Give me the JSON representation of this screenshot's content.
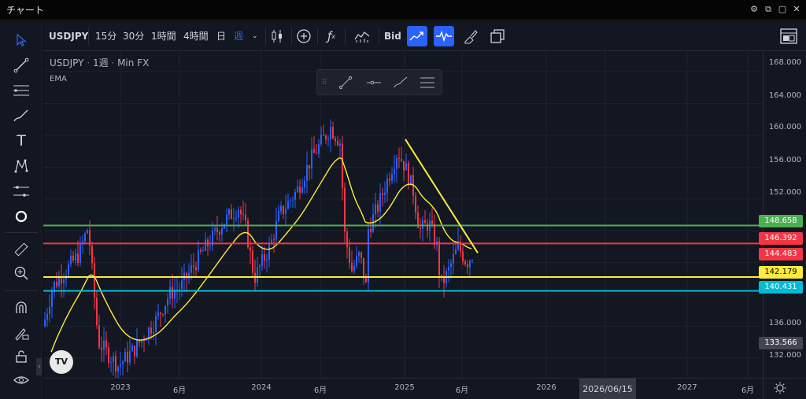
{
  "window": {
    "title": "チャート"
  },
  "toolbar": {
    "symbol": "USDJPY",
    "intervals": [
      "15分",
      "30分",
      "1時間",
      "4時間",
      "日",
      "週"
    ],
    "active_interval": "週",
    "bid_label": "Bid"
  },
  "legend": {
    "symbol": "USDJPY",
    "interval": "1週",
    "source": "Min FX",
    "indicator": "EMA"
  },
  "price_axis": {
    "ticks": [
      "168.000",
      "164.000",
      "160.000",
      "156.000",
      "152.000",
      "136.000",
      "132.000"
    ],
    "labels": [
      {
        "value": "148.658",
        "bg": "#4caf50",
        "fg": "#ffffff"
      },
      {
        "value": "146.392",
        "bg": "#f23645",
        "fg": "#ffffff"
      },
      {
        "value": "144.483",
        "bg": "#f23645",
        "fg": "#ffffff"
      },
      {
        "value": "142.179",
        "bg": "#ffeb3b",
        "fg": "#000000"
      },
      {
        "value": "140.431",
        "bg": "#00bcd4",
        "fg": "#ffffff"
      },
      {
        "value": "133.566",
        "bg": "#434651",
        "fg": "#ffffff"
      }
    ]
  },
  "time_axis": {
    "labels": [
      "2023",
      "6月",
      "2024",
      "6月",
      "2025",
      "6月",
      "2026",
      "2027",
      "6月"
    ],
    "cursor": "2026/06/15"
  },
  "chart_data": {
    "type": "candlestick",
    "ylim": [
      129.5,
      170.6
    ],
    "horizontal_lines": [
      {
        "price": 148.658,
        "color": "#4caf50"
      },
      {
        "price": 146.392,
        "color": "#f23645"
      },
      {
        "price": 142.179,
        "color": "#ffeb3b"
      },
      {
        "price": 140.431,
        "color": "#00bcd4"
      }
    ],
    "last_price": 144.483,
    "colors": {
      "up": "#2962ff",
      "down": "#f23645",
      "ema": "#ffeb3b"
    }
  }
}
